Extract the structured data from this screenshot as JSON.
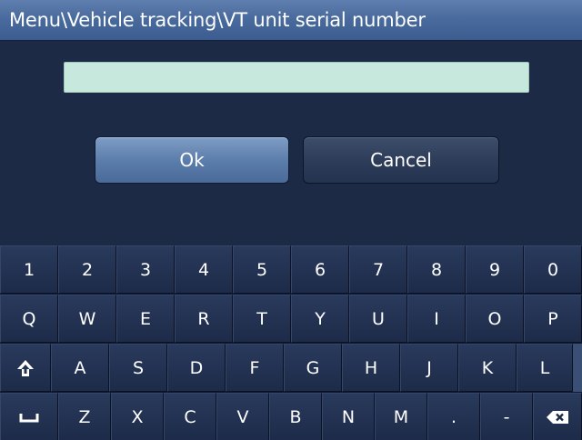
{
  "title": "Menu\\Vehicle tracking\\VT unit serial number",
  "serial_input": {
    "value": "",
    "placeholder": ""
  },
  "buttons": {
    "ok": "Ok",
    "cancel": "Cancel"
  },
  "keyboard": {
    "row1": [
      "1",
      "2",
      "3",
      "4",
      "5",
      "6",
      "7",
      "8",
      "9",
      "0"
    ],
    "row2": [
      "Q",
      "W",
      "E",
      "R",
      "T",
      "Y",
      "U",
      "I",
      "O",
      "P"
    ],
    "row3": [
      "A",
      "S",
      "D",
      "F",
      "G",
      "H",
      "J",
      "K",
      "L"
    ],
    "row4": [
      "Z",
      "X",
      "C",
      "V",
      "B",
      "N",
      "M",
      ".",
      "-"
    ],
    "icons": {
      "shift": "shift-icon",
      "space": "space-icon",
      "backspace": "backspace-icon"
    }
  },
  "colors": {
    "title_bar": "#4a6b9d",
    "background": "#1d2a46",
    "input_fill": "#c7e8dd",
    "ok_button": "#5c7eac",
    "cancel_button": "#2d3d5a",
    "key": "#23324f"
  }
}
